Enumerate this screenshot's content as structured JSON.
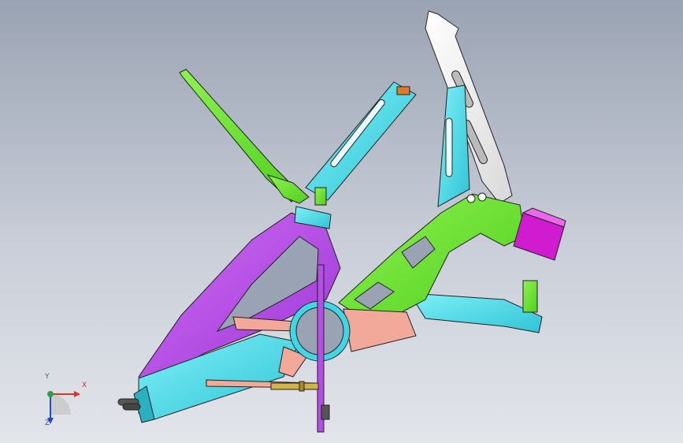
{
  "viewport": {
    "background_top": "#9aa3b3",
    "background_bottom": "#e2e5ea"
  },
  "triad": {
    "x_label": "X",
    "y_label": "Y",
    "z_label": "Z",
    "x_color": "#d9342b",
    "y_color": "#2ea043",
    "z_color": "#2349c9"
  },
  "parts": {
    "frame_color_purple": "#b54ee6",
    "frame_color_green": "#6ee62e",
    "frame_color_cyan": "#3fd6e6",
    "frame_color_white": "#f2f2f2",
    "frame_color_magenta": "#d11bd1",
    "frame_color_salmon": "#f2a99a",
    "frame_color_orange": "#e07a2a"
  }
}
